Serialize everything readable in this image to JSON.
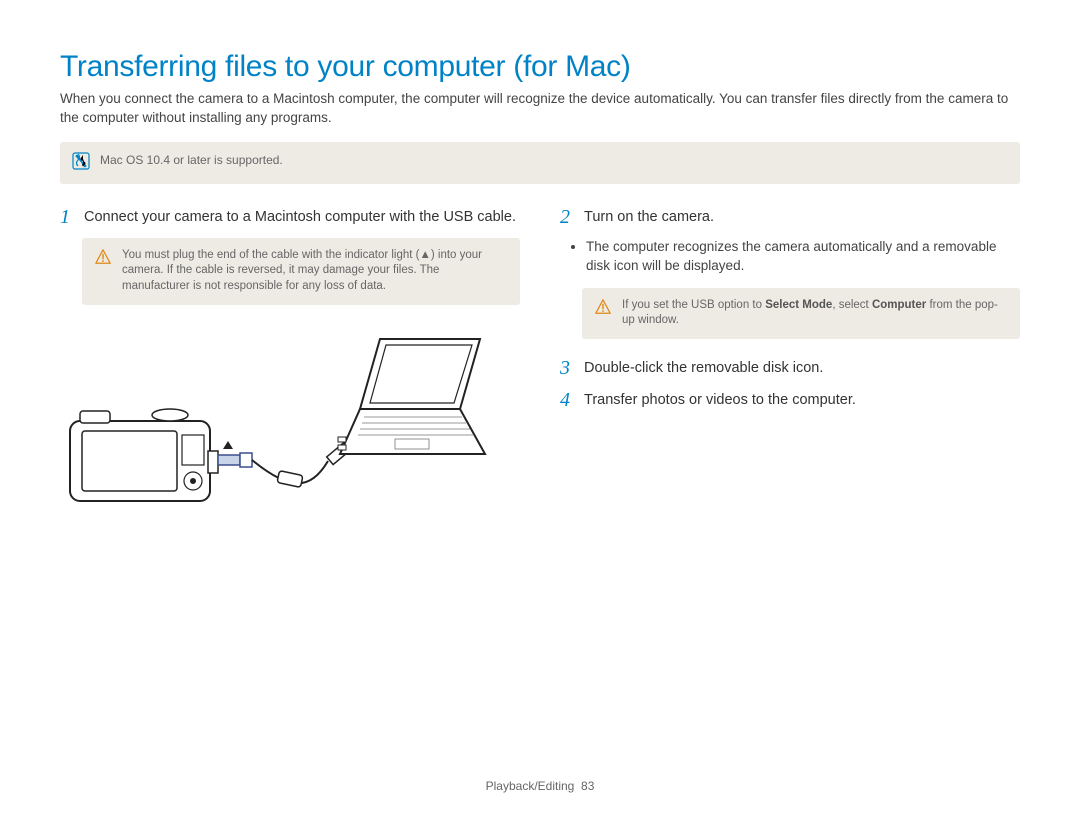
{
  "title": "Transferring files to your computer (for Mac)",
  "intro": "When you connect the camera to a Macintosh computer, the computer will recognize the device automatically. You can transfer files directly from the camera to the computer without installing any programs.",
  "info_note": "Mac OS 10.4 or later is supported.",
  "left": {
    "step1_num": "1",
    "step1_text": "Connect your camera to a Macintosh computer with the USB cable.",
    "caution": "You must plug the end of the cable with the indicator light (▲) into your camera. If the cable is reversed, it may damage your files. The manufacturer is not responsible for any loss of data."
  },
  "right": {
    "step2_num": "2",
    "step2_text": "Turn on the camera.",
    "step2_bullet": "The computer recognizes the camera automatically and a removable disk icon will be displayed.",
    "caution_prefix": "If you set the USB option to ",
    "caution_bold1": "Select Mode",
    "caution_mid": ", select ",
    "caution_bold2": "Computer",
    "caution_suffix": " from the pop-up window.",
    "step3_num": "3",
    "step3_text": "Double-click the removable disk icon.",
    "step4_num": "4",
    "step4_text": "Transfer photos or videos to the computer."
  },
  "footer_section": "Playback/Editing",
  "footer_page": "83"
}
